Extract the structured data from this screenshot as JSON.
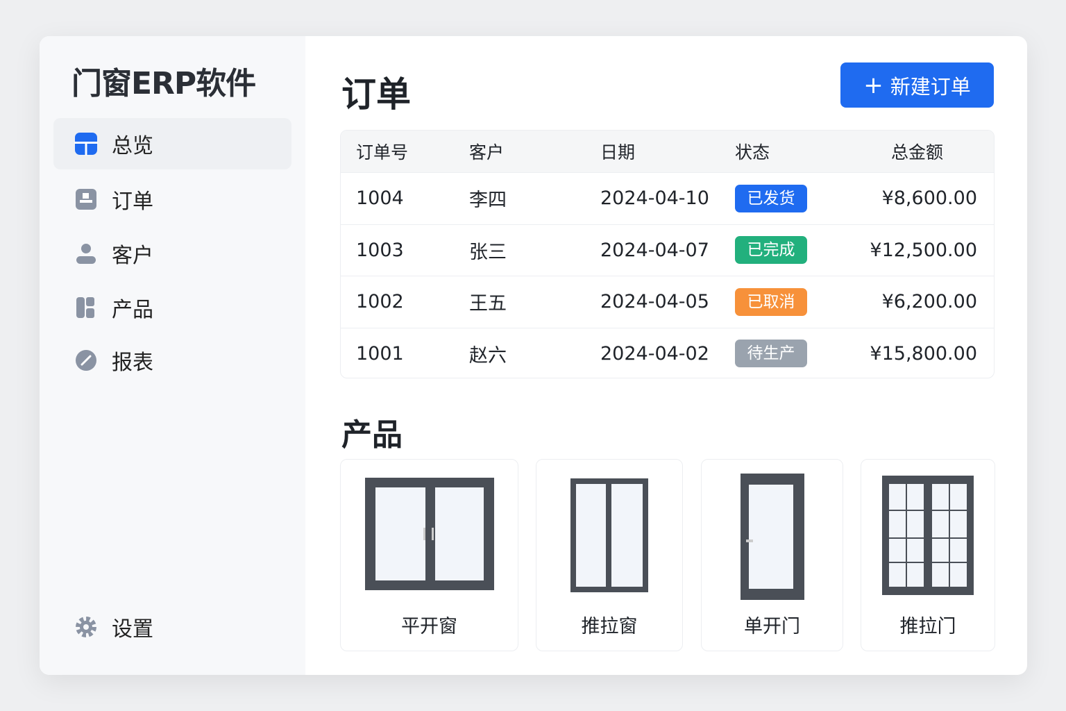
{
  "app_title": "门窗ERP软件",
  "sidebar": {
    "items": [
      {
        "label": "总览",
        "icon": "dashboard-icon"
      },
      {
        "label": "订单",
        "icon": "order-icon"
      },
      {
        "label": "客户",
        "icon": "user-icon"
      },
      {
        "label": "产品",
        "icon": "product-icon"
      },
      {
        "label": "报表",
        "icon": "report-icon"
      }
    ],
    "settings": "设置"
  },
  "orders": {
    "title": "订单",
    "new_button": "新建订单",
    "columns": [
      "订单号",
      "客户",
      "日期",
      "状态",
      "总金额"
    ],
    "rows": [
      {
        "id": "1004",
        "customer": "李四",
        "date": "2024-04-10",
        "status": "已发货",
        "color": "#1f6bf0",
        "amount": "¥8,600.00"
      },
      {
        "id": "1003",
        "customer": "张三",
        "date": "2024-04-07",
        "status": "已完成",
        "color": "#22b07d",
        "amount": "¥12,500.00"
      },
      {
        "id": "1002",
        "customer": "王五",
        "date": "2024-04-05",
        "status": "已取消",
        "color": "#f7913a",
        "amount": "¥6,200.00"
      },
      {
        "id": "1001",
        "customer": "赵六",
        "date": "2024-04-02",
        "status": "待生产",
        "color": "#9aa3ae",
        "amount": "¥15,800.00"
      }
    ]
  },
  "products": {
    "title": "产品",
    "items": [
      "平开窗",
      "推拉窗",
      "单开门",
      "推拉门"
    ]
  }
}
